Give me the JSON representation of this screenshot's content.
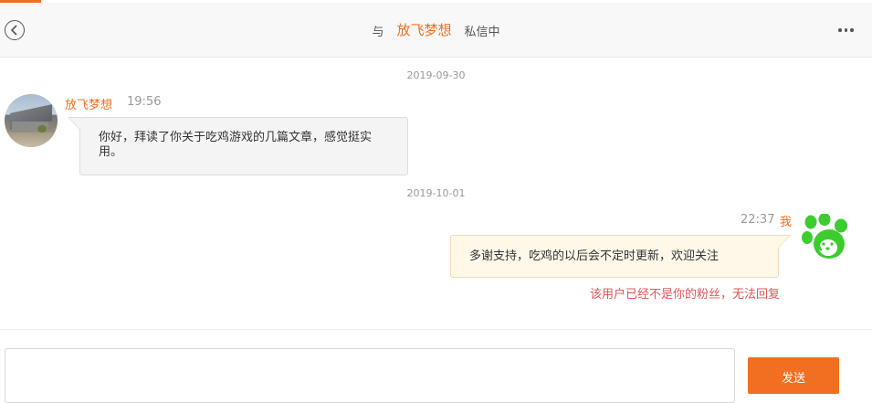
{
  "header": {
    "with_label": "与",
    "contact_name": "放飞梦想",
    "status_label": "私信中",
    "back_icon": "chevron-left-circle-icon",
    "more_icon": "more-horizontal-icon"
  },
  "messages": [
    {
      "date": "2019-09-30",
      "sender": "放飞梦想",
      "time": "19:56",
      "text": "你好，拜读了你关于吃鸡游戏的几篇文章，感觉挺实用。",
      "side": "left",
      "avatar": "building-photo-avatar"
    },
    {
      "date": "2019-10-01",
      "sender": "我",
      "time": "22:37",
      "text": "多谢支持，吃鸡的以后会不定时更新，欢迎关注",
      "side": "right",
      "avatar": "green-paw-dog-avatar",
      "notice": "该用户已经不是你的粉丝，无法回复"
    }
  ],
  "composer": {
    "input_value": "",
    "send_label": "发送"
  },
  "colors": {
    "accent": "#f26f21",
    "warning": "#e0555a",
    "my_bubble": "#fff8e9",
    "their_bubble": "#f4f4f4"
  }
}
